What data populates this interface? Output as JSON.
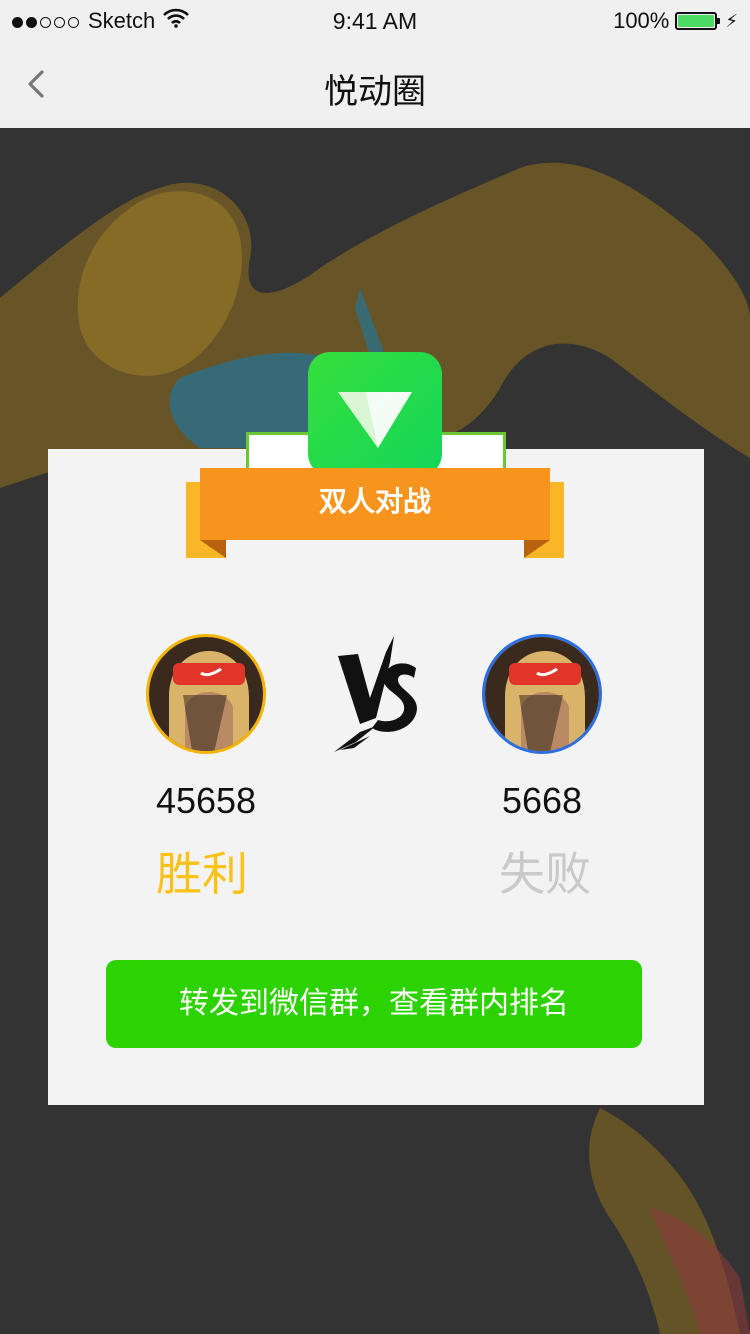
{
  "status_bar": {
    "carrier": "Sketch",
    "time": "9:41 AM",
    "battery_percent": "100%",
    "signal_bars_filled": 2,
    "signal_bars_total": 5,
    "battery_color": "#4cd964"
  },
  "nav": {
    "title": "悦动圈",
    "back_icon": "chevron-left-icon"
  },
  "card": {
    "badge_label": "双人对战",
    "vs_icon": "vs-icon",
    "players": {
      "left": {
        "score": "45658",
        "result": "胜利",
        "ring_color": "#f5b400",
        "result_color": "#f8c218"
      },
      "right": {
        "score": "5668",
        "result": "失败",
        "ring_color": "#2d6fe0",
        "result_color": "#c9c9c9"
      }
    },
    "share_button": "转发到微信群，查看群内排名"
  },
  "colors": {
    "brand_green": "#2dd300",
    "ribbon_orange": "#f7941d",
    "background_dark": "#333333"
  }
}
